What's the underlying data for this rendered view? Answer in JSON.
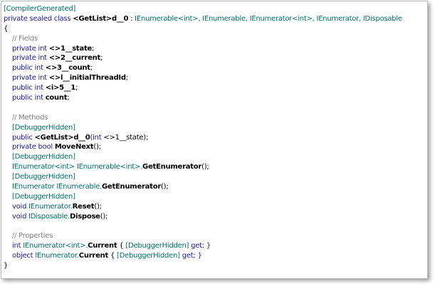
{
  "colors": {
    "keyword": "#1a1aa6",
    "attribute": "#006d6d",
    "comment": "#7f7f7f",
    "text": "#000000",
    "frame_border": "#b9b9b9",
    "background": "#ffffff"
  },
  "code_lines": [
    {
      "indent": 0,
      "tokens": [
        {
          "t": "[CompilerGenerated]",
          "s": "attr"
        }
      ]
    },
    {
      "indent": 0,
      "tokens": [
        {
          "t": "private sealed class ",
          "s": "kw"
        },
        {
          "t": "<GetList>d__0",
          "s": "b"
        },
        {
          "t": " : ",
          "s": "pl"
        },
        {
          "t": "IEnumerable<int>, IEnumerable, IEnumerator<int>, IEnumerator, IDisposable",
          "s": "attr"
        }
      ]
    },
    {
      "indent": 0,
      "tokens": [
        {
          "t": "{",
          "s": "pl"
        }
      ]
    },
    {
      "indent": 1,
      "tokens": [
        {
          "t": "// Fields",
          "s": "cm"
        }
      ]
    },
    {
      "indent": 1,
      "tokens": [
        {
          "t": "private int ",
          "s": "kw"
        },
        {
          "t": "<>1__state",
          "s": "b"
        },
        {
          "t": ";",
          "s": "pl"
        }
      ]
    },
    {
      "indent": 1,
      "tokens": [
        {
          "t": "private int ",
          "s": "kw"
        },
        {
          "t": "<>2__current",
          "s": "b"
        },
        {
          "t": ";",
          "s": "pl"
        }
      ]
    },
    {
      "indent": 1,
      "tokens": [
        {
          "t": "public int ",
          "s": "kw"
        },
        {
          "t": "<>3__count",
          "s": "b"
        },
        {
          "t": ";",
          "s": "pl"
        }
      ]
    },
    {
      "indent": 1,
      "tokens": [
        {
          "t": "private int ",
          "s": "kw"
        },
        {
          "t": "<>l__initialThreadId",
          "s": "b"
        },
        {
          "t": ";",
          "s": "pl"
        }
      ]
    },
    {
      "indent": 1,
      "tokens": [
        {
          "t": "public int ",
          "s": "kw"
        },
        {
          "t": "<i>5__1",
          "s": "b"
        },
        {
          "t": ";",
          "s": "pl"
        }
      ]
    },
    {
      "indent": 1,
      "tokens": [
        {
          "t": "public int ",
          "s": "kw"
        },
        {
          "t": "count",
          "s": "b"
        },
        {
          "t": ";",
          "s": "pl"
        }
      ]
    },
    {
      "indent": 1,
      "tokens": []
    },
    {
      "indent": 1,
      "tokens": [
        {
          "t": "// Methods",
          "s": "cm"
        }
      ]
    },
    {
      "indent": 1,
      "tokens": [
        {
          "t": "[DebuggerHidden]",
          "s": "attr"
        }
      ]
    },
    {
      "indent": 1,
      "tokens": [
        {
          "t": "public ",
          "s": "kw"
        },
        {
          "t": "<GetList>d__0",
          "s": "b"
        },
        {
          "t": "(int ",
          "s": "kw"
        },
        {
          "t": "<>1__state",
          "s": "pl"
        },
        {
          "t": ");",
          "s": "pl"
        }
      ]
    },
    {
      "indent": 1,
      "tokens": [
        {
          "t": "private bool ",
          "s": "kw"
        },
        {
          "t": "MoveNext",
          "s": "b"
        },
        {
          "t": "();",
          "s": "pl"
        }
      ]
    },
    {
      "indent": 1,
      "tokens": [
        {
          "t": "[DebuggerHidden]",
          "s": "attr"
        }
      ]
    },
    {
      "indent": 1,
      "tokens": [
        {
          "t": "IEnumerator<int> IEnumerable<int>.",
          "s": "attr"
        },
        {
          "t": "GetEnumerator",
          "s": "b"
        },
        {
          "t": "();",
          "s": "pl"
        }
      ]
    },
    {
      "indent": 1,
      "tokens": [
        {
          "t": "[DebuggerHidden]",
          "s": "attr"
        }
      ]
    },
    {
      "indent": 1,
      "tokens": [
        {
          "t": "IEnumerator IEnumerable.",
          "s": "attr"
        },
        {
          "t": "GetEnumerator",
          "s": "b"
        },
        {
          "t": "();",
          "s": "pl"
        }
      ]
    },
    {
      "indent": 1,
      "tokens": [
        {
          "t": "[DebuggerHidden]",
          "s": "attr"
        }
      ]
    },
    {
      "indent": 1,
      "tokens": [
        {
          "t": "void ",
          "s": "kw"
        },
        {
          "t": "IEnumerator.",
          "s": "attr"
        },
        {
          "t": "Reset",
          "s": "b"
        },
        {
          "t": "();",
          "s": "pl"
        }
      ]
    },
    {
      "indent": 1,
      "tokens": [
        {
          "t": "void ",
          "s": "kw"
        },
        {
          "t": "IDisposable.",
          "s": "attr"
        },
        {
          "t": "Dispose",
          "s": "b"
        },
        {
          "t": "();",
          "s": "pl"
        }
      ]
    },
    {
      "indent": 1,
      "tokens": []
    },
    {
      "indent": 1,
      "tokens": [
        {
          "t": "// Properties",
          "s": "cm"
        }
      ]
    },
    {
      "indent": 1,
      "tokens": [
        {
          "t": "int ",
          "s": "kw"
        },
        {
          "t": "IEnumerator<int>.",
          "s": "attr"
        },
        {
          "t": "Current",
          "s": "b"
        },
        {
          "t": " { ",
          "s": "pl"
        },
        {
          "t": "[DebuggerHidden]",
          "s": "attr"
        },
        {
          "t": " get; }",
          "s": "kw"
        }
      ]
    },
    {
      "indent": 1,
      "tokens": [
        {
          "t": "object ",
          "s": "kw"
        },
        {
          "t": "IEnumerator.",
          "s": "attr"
        },
        {
          "t": "Current",
          "s": "b"
        },
        {
          "t": " { ",
          "s": "pl"
        },
        {
          "t": "[DebuggerHidden]",
          "s": "attr"
        },
        {
          "t": " get; }",
          "s": "kw"
        }
      ]
    },
    {
      "indent": 0,
      "tokens": [
        {
          "t": "}",
          "s": "pl"
        }
      ]
    }
  ]
}
